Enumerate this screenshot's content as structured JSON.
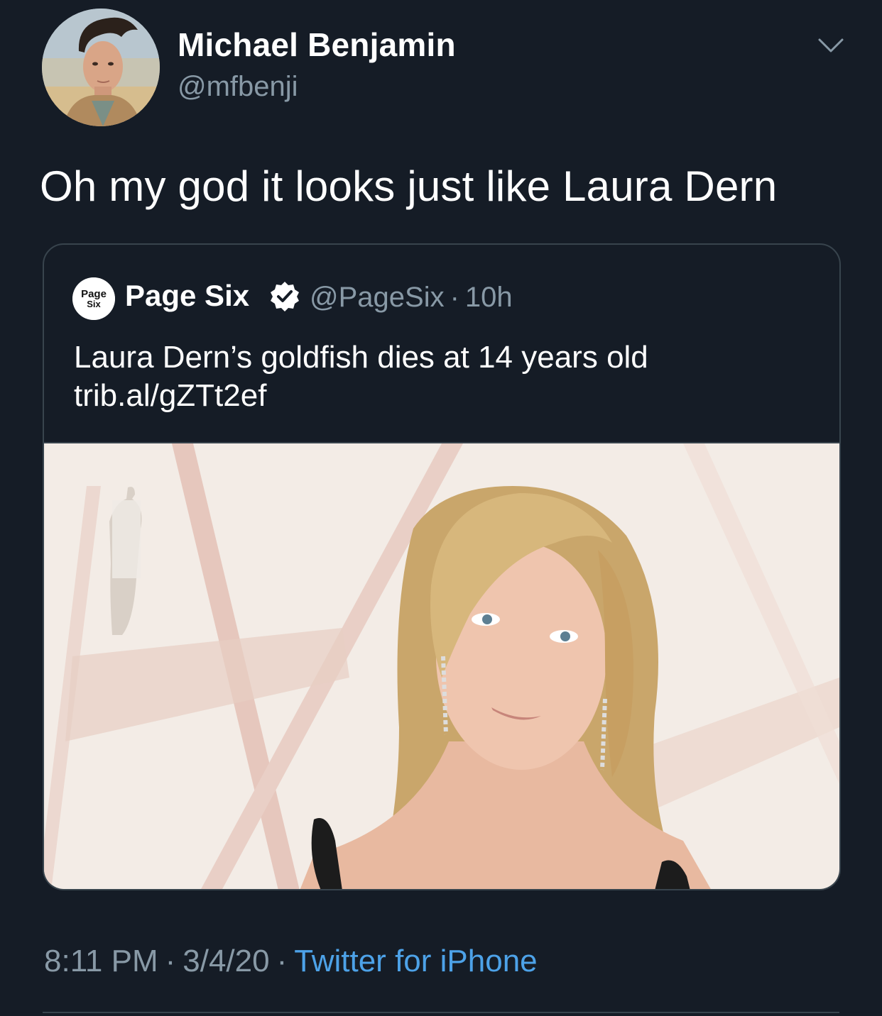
{
  "tweet": {
    "author": {
      "name": "Michael Benjamin",
      "handle": "@mfbenji"
    },
    "text": "Oh my god it looks just like Laura Dern",
    "menu_icon": "chevron-down-icon"
  },
  "quote": {
    "avatar_text_top": "Page",
    "avatar_text_bottom": "Six",
    "name": "Page Six",
    "verified_icon": "verified-badge-icon",
    "handle": "@PageSix",
    "separator": "·",
    "time": "10h",
    "text_line1": "Laura Dern’s goldfish dies at 14 years old",
    "text_line2": "trib.al/gZTt2ef"
  },
  "footer": {
    "time": "8:11 PM",
    "date": "3/4/20",
    "separator": "·",
    "source": "Twitter for iPhone"
  },
  "colors": {
    "background": "#151c26",
    "text_primary": "#ffffff",
    "text_secondary": "#8899a6",
    "link": "#4da2e8",
    "border": "#38444d"
  }
}
